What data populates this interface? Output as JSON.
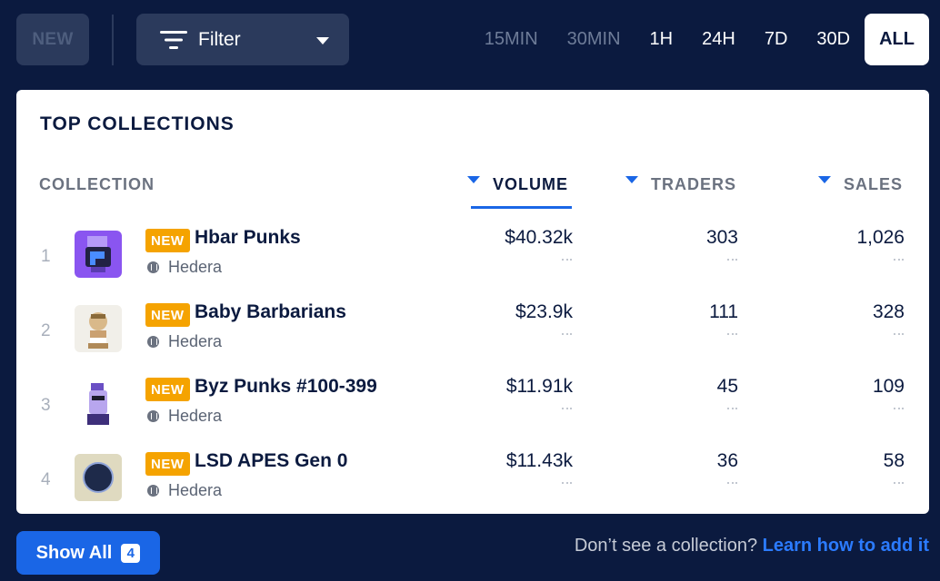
{
  "topbar": {
    "new_label": "NEW",
    "filter_label": "Filter",
    "time_tabs": [
      "15MIN",
      "30MIN",
      "1H",
      "24H",
      "7D",
      "30D",
      "ALL"
    ],
    "active_tab": "ALL"
  },
  "card": {
    "title": "TOP COLLECTIONS",
    "columns": {
      "collection": "COLLECTION",
      "volume": "VOLUME",
      "traders": "TRADERS",
      "sales": "SALES"
    },
    "badge_label": "NEW",
    "rows": [
      {
        "rank": "1",
        "name": "Hbar Punks",
        "chain": "Hedera",
        "volume": "$40.32k",
        "traders": "303",
        "sales": "1,026"
      },
      {
        "rank": "2",
        "name": "Baby Barbarians",
        "chain": "Hedera",
        "volume": "$23.9k",
        "traders": "111",
        "sales": "328"
      },
      {
        "rank": "3",
        "name": "Byz Punks #100-399",
        "chain": "Hedera",
        "volume": "$11.91k",
        "traders": "45",
        "sales": "109"
      },
      {
        "rank": "4",
        "name": "LSD APES Gen 0",
        "chain": "Hedera",
        "volume": "$11.43k",
        "traders": "36",
        "sales": "58"
      }
    ]
  },
  "footer": {
    "show_all_label": "Show All",
    "show_all_count": "4",
    "prompt_text": "Don’t see a collection?",
    "link_text": "Learn how to add it"
  },
  "colors": {
    "background": "#0b1a3f",
    "accent": "#1a66e6",
    "badge": "#f5a300"
  }
}
